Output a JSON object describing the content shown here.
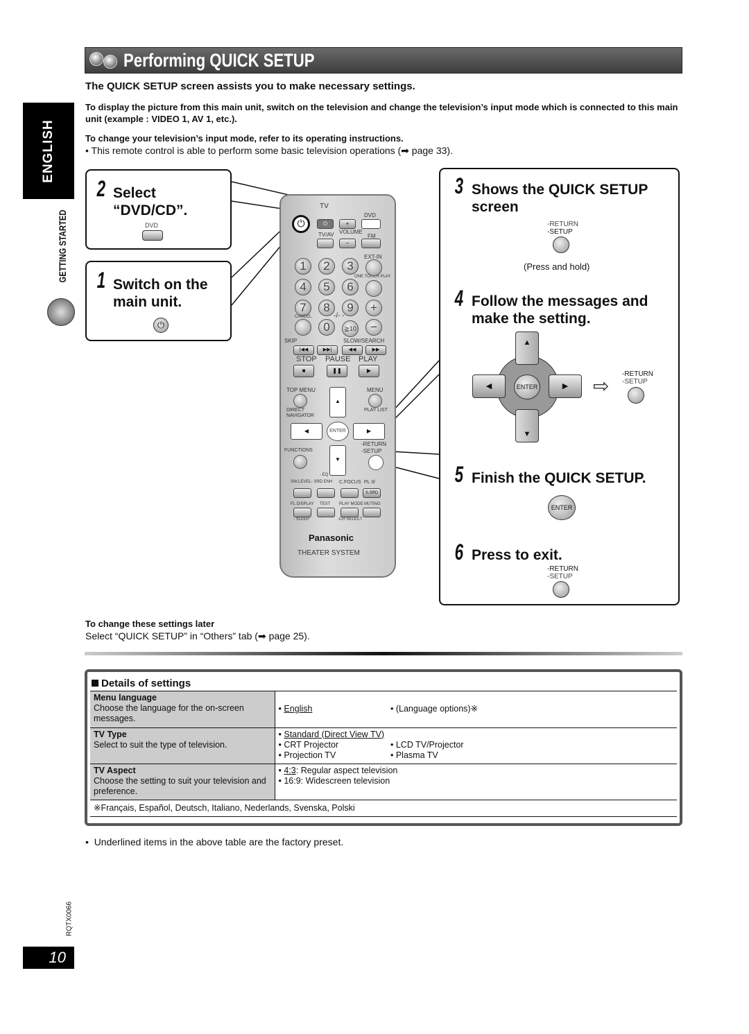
{
  "header": {
    "title": "Performing QUICK SETUP",
    "icon": "discs-icon"
  },
  "subtitle": "The QUICK SETUP screen assists you to make necessary settings.",
  "intro": [
    "To display the picture from this main unit, switch on the television and change the television’s input mode which is connected to this main unit (example : VIDEO 1, AV 1, etc.).",
    "To change your television’s input mode, refer to its operating instructions."
  ],
  "bullet": "This remote control is able to perform some basic television operations (➡ page 33).",
  "side": {
    "language": "ENGLISH",
    "section": "GETTING STARTED",
    "rqt": "RQTX0066",
    "page": "10"
  },
  "steps": [
    {
      "n": "2",
      "title": "Select “DVD/CD”.",
      "button": "DVD"
    },
    {
      "n": "1",
      "title": "Switch on the main unit."
    },
    {
      "n": "3",
      "title": "Shows the QUICK SETUP screen",
      "return": "-RETURN",
      "setup": "-SETUP",
      "note": "(Press and hold)"
    },
    {
      "n": "4",
      "title": "Follow the messages and make the setting.",
      "enter": "ENTER",
      "return": "-RETURN",
      "setup": "-SETUP"
    },
    {
      "n": "5",
      "title": "Finish the QUICK SETUP.",
      "enter": "ENTER"
    },
    {
      "n": "6",
      "title": "Press to exit.",
      "return": "-RETURN",
      "setup": "-SETUP"
    }
  ],
  "remote": {
    "tv": "TV",
    "dvd": "DVD",
    "tvav": "TV/AV",
    "volume": "VOLUME",
    "fm": "FM",
    "extin": "EXT-IN",
    "otp": "ONE TOUCH PLAY",
    "numbers": [
      "1",
      "2",
      "3",
      "4",
      "5",
      "6",
      "7",
      "8",
      "9",
      "0"
    ],
    "cancel": "CANCEL",
    "tens": "≧10",
    "dash": "-/- -",
    "skip": "SKIP",
    "slow": "SLOW/SEARCH",
    "stop": "STOP",
    "pause": "PAUSE",
    "play": "PLAY",
    "topmenu": "TOP MENU",
    "menu": "MENU",
    "direct": "DIRECT NAVIGATOR",
    "playlist": "PLAY LIST",
    "enter": "ENTER",
    "functions": "FUNCTIONS",
    "return": "-RETURN",
    "setup": "-SETUP",
    "eq": "- EQ",
    "swlevel": "SW.LEVEL- SRD ENH",
    "cfocus": "C.FOCUS",
    "pl2": "PL II/",
    "ssrd": "S.SRD",
    "fl": "FL DISPLAY",
    "test": "TEST",
    "playmode": "PLAY MODE",
    "muting": "MUTING",
    "sleep": "- SLEEP",
    "chselect": "-CH SELECT",
    "brand": "Panasonic",
    "model": "THEATER SYSTEM"
  },
  "later": {
    "title": "To change these settings later",
    "text": "Select “QUICK SETUP” in “Others” tab (➡ page 25)."
  },
  "details": {
    "title": "Details of settings",
    "rows": [
      {
        "name": "Menu language",
        "desc": "Choose the language for the on-screen messages.",
        "opts": [
          [
            "English",
            "• (Language options)※"
          ]
        ]
      },
      {
        "name": "TV Type",
        "desc": "Select to suit the type of television.",
        "opts": [
          [
            "Standard (Direct View TV)",
            ""
          ],
          [
            "• CRT Projector",
            "• LCD TV/Projector"
          ],
          [
            "• Projection TV",
            "• Plasma TV"
          ]
        ]
      },
      {
        "name": "TV Aspect",
        "desc": "Choose the setting to suit your television and preference.",
        "opts": [
          [
            "4:3",
            ": Regular aspect television"
          ],
          [
            "• 16:9: Widescreen television",
            ""
          ]
        ]
      }
    ],
    "footnote": "※Français, Español, Deutsch, Italiano, Nederlands, Svenska, Polski"
  },
  "note": "Underlined items in the above table are the factory preset."
}
